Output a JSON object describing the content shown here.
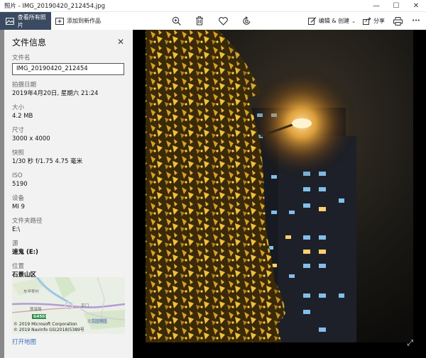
{
  "window": {
    "title": "照片 - IMG_20190420_212454.jpg",
    "minimize_glyph": "—",
    "maximize_glyph": "☐",
    "close_glyph": "✕"
  },
  "toolbar": {
    "view_all_label": "查看所有照片",
    "add_label": "添加到新作品",
    "edit_create_label": "编辑 & 创建",
    "share_label": "分享",
    "more_glyph": "···",
    "icons": [
      "zoom-icon",
      "delete-icon",
      "favorite-icon",
      "rotate-icon",
      "edit-icon",
      "share-icon",
      "print-icon",
      "more-icon"
    ]
  },
  "info_panel": {
    "title": "文件信息",
    "close_glyph": "✕",
    "filename_label": "文件名",
    "filename_value": "IMG_20190420_212454",
    "date_label": "拍摄日期",
    "date_value": "2019年4月20日, 星期六 21:24",
    "size_label": "大小",
    "size_value": "4.2 MB",
    "dimensions_label": "尺寸",
    "dimensions_value": "3000 x 4000",
    "shutter_label": "快照",
    "shutter_value": "1/30 秒 f/1.75 4.75 毫米",
    "iso_label": "ISO",
    "iso_value": "5190",
    "device_label": "设备",
    "device_value": "MI 9",
    "folder_label": "文件夹路径",
    "folder_value": "E:\\",
    "source_label": "源",
    "source_value": "速鬼 (E:)",
    "location_label": "位置",
    "location_value": "石景山区",
    "map_labels": {
      "village": "东辛称村",
      "road_a": "莲溪路",
      "road_b": "京门",
      "highway": "G4501",
      "park": "北京园博园"
    },
    "map_credit_1": "© 2019 Microsoft Corporation",
    "map_credit_2": "© 2019 NavInfo GS(2018)5389号",
    "open_map_label": "打开地图"
  },
  "colors": {
    "accent": "#3a4a60",
    "link": "#3a6fb8",
    "lamp": "#ffb640"
  }
}
